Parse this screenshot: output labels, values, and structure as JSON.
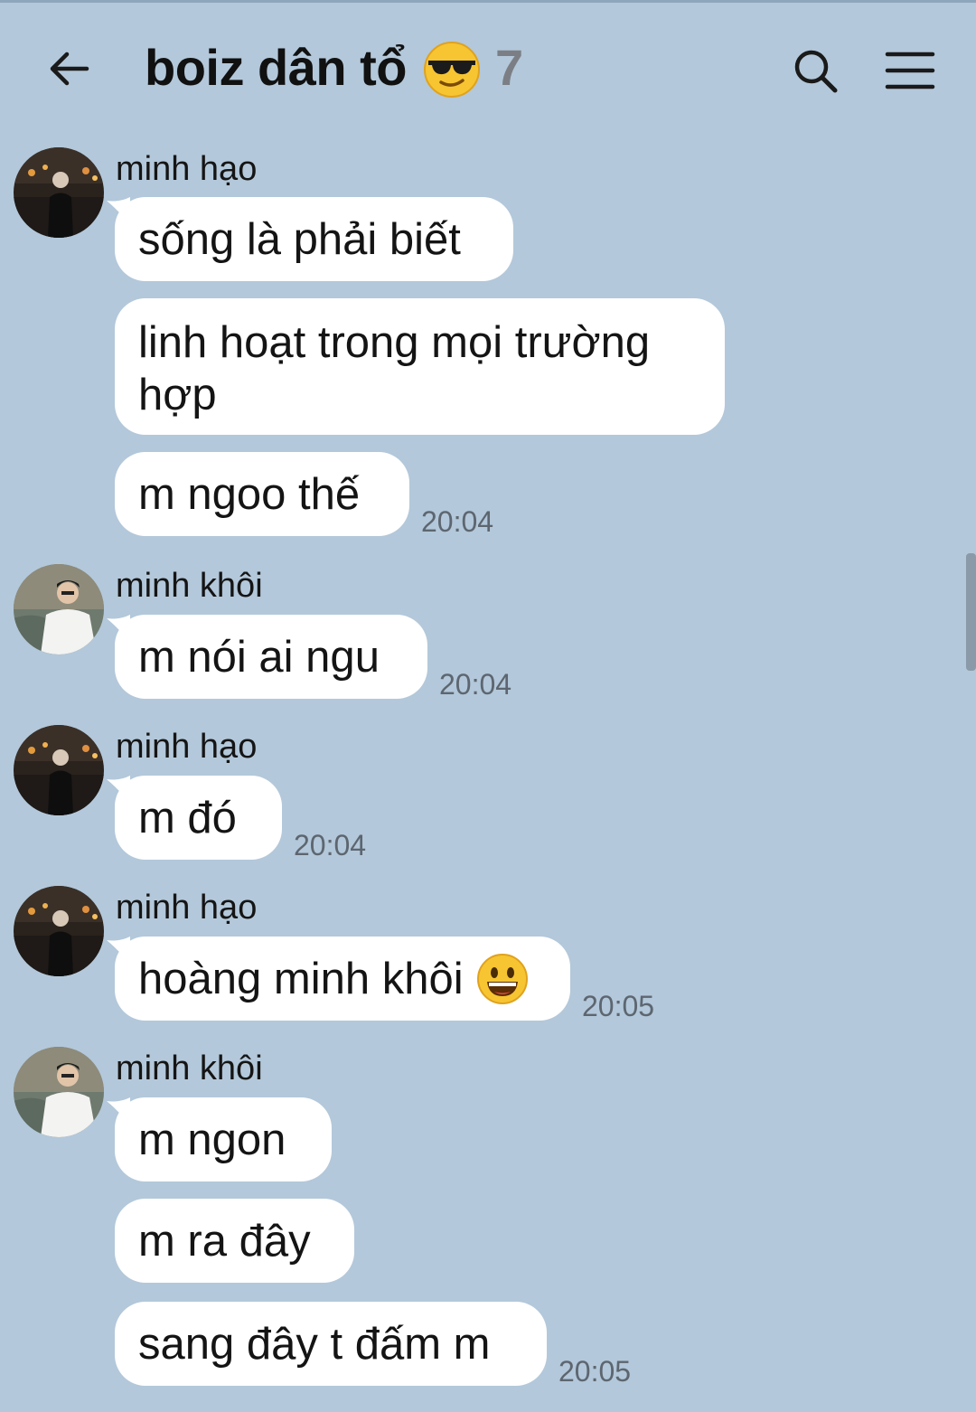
{
  "header": {
    "back_icon": "arrow-left-icon",
    "title": "boiz dân tổ",
    "title_emoji": "sunglasses-emoji",
    "member_count": "7",
    "search_icon": "search-icon",
    "menu_icon": "hamburger-menu-icon"
  },
  "colors": {
    "background": "#b3c8da",
    "bubble": "#ffffff",
    "time": "#5d6670",
    "member_count": "#7b7f85"
  },
  "messages": [
    {
      "sender": "minh hạo",
      "avatar": "avatar-minh-hao",
      "bubbles": [
        "sống là phải biết",
        "linh hoạt trong mọi trường hợp",
        "m ngoo thế"
      ],
      "time": "20:04"
    },
    {
      "sender": "minh khôi",
      "avatar": "avatar-minh-khoi",
      "bubbles": [
        "m nói ai ngu"
      ],
      "time": "20:04"
    },
    {
      "sender": "minh hạo",
      "avatar": "avatar-minh-hao",
      "bubbles": [
        "m đó"
      ],
      "time": "20:04"
    },
    {
      "sender": "minh hạo",
      "avatar": "avatar-minh-hao",
      "bubbles": [
        "hoàng minh khôi"
      ],
      "bubble_emoji": "grinning-face-emoji",
      "time": "20:05"
    },
    {
      "sender": "minh khôi",
      "avatar": "avatar-minh-khoi",
      "bubbles": [
        "m ngon",
        "m ra đây",
        "sang đây t đấm m"
      ],
      "time": "20:05"
    }
  ]
}
